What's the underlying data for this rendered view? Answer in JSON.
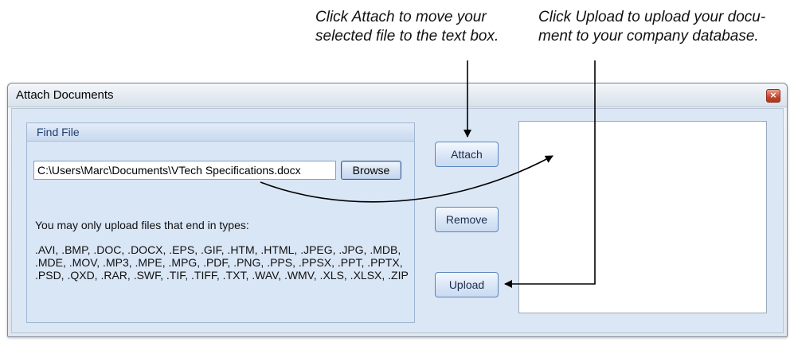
{
  "callouts": {
    "attach": {
      "line1": "Click Attach to move your",
      "line2": "selected file to the text box."
    },
    "upload": {
      "line1": "Click Upload to upload your docu-",
      "line2": "ment to your company database."
    }
  },
  "window": {
    "title": "Attach Documents",
    "close_glyph": "×"
  },
  "find_file": {
    "header": "Find File",
    "path_value": "C:\\Users\\Marc\\Documents\\VTech Specifications.docx",
    "browse_label": "Browse",
    "types_label": "You may only upload files that end in types:",
    "types_list": ".AVI, .BMP, .DOC, .DOCX, .EPS, .GIF, .HTM, .HTML, .JPEG, .JPG, .MDB, .MDE, .MOV, .MP3, .MPE, .MPG, .PDF, .PNG, .PPS, .PPSX, .PPT, .PPTX, .PSD, .QXD, .RAR, .SWF, .TIF, .TIFF, .TXT, .WAV, .WMV, .XLS, .XLSX, .ZIP"
  },
  "buttons": {
    "attach": "Attach",
    "remove": "Remove",
    "upload": "Upload"
  },
  "icons": {
    "close": "close-icon"
  }
}
